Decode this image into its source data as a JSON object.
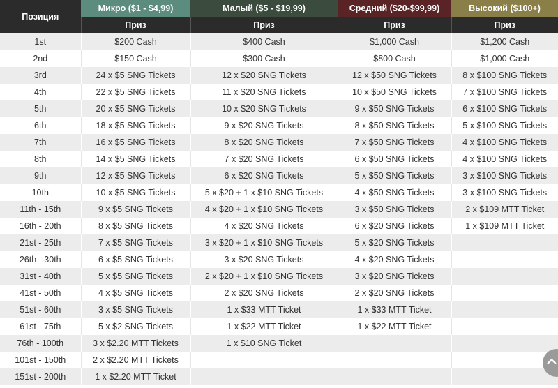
{
  "headers": {
    "position": "Позиция",
    "tiers": [
      "Микро ($1 - $4,99)",
      "Малый ($5 - $19,99)",
      "Средний ($20-$99,99)",
      "Высокий ($100+)"
    ],
    "prize_label": "Приз"
  },
  "tier_colors": {
    "micro": "#5c8c7d",
    "small": "#3b4b3d",
    "mid": "#5a2426",
    "high": "#8a7f49"
  },
  "rows": [
    [
      "1st",
      "$200 Cash",
      "$400 Cash",
      "$1,000 Cash",
      "$1,200 Cash"
    ],
    [
      "2nd",
      "$150 Cash",
      "$300 Cash",
      "$800 Cash",
      "$1,000 Cash"
    ],
    [
      "3rd",
      "24 x $5 SNG Tickets",
      "12 x $20 SNG Tickets",
      "12 x $50 SNG Tickets",
      "8 x $100 SNG Tickets"
    ],
    [
      "4th",
      "22 x $5 SNG Tickets",
      "11 x $20 SNG Tickets",
      "10 x $50 SNG Tickets",
      "7 x $100 SNG Tickets"
    ],
    [
      "5th",
      "20 x $5 SNG Tickets",
      "10 x $20 SNG Tickets",
      "9 x $50 SNG Tickets",
      "6 x $100 SNG Tickets"
    ],
    [
      "6th",
      "18 x $5 SNG Tickets",
      "9 x $20 SNG Tickets",
      "8 x $50 SNG Tickets",
      "5 x $100 SNG Tickets"
    ],
    [
      "7th",
      "16 x $5 SNG Tickets",
      "8 x $20 SNG Tickets",
      "7 x $50 SNG Tickets",
      "4 x $100 SNG Tickets"
    ],
    [
      "8th",
      "14 x $5 SNG Tickets",
      "7 x $20 SNG Tickets",
      "6 x $50 SNG Tickets",
      "4 x $100 SNG Tickets"
    ],
    [
      "9th",
      "12 x $5 SNG Tickets",
      "6 x $20 SNG Tickets",
      "5 x $50 SNG Tickets",
      "3 x $100 SNG Tickets"
    ],
    [
      "10th",
      "10 x $5 SNG Tickets",
      "5 x $20 + 1 x $10 SNG Tickets",
      "4 x $50 SNG Tickets",
      "3 x $100 SNG Tickets"
    ],
    [
      "11th - 15th",
      "9 x $5 SNG Tickets",
      "4 x $20 + 1 x $10 SNG Tickets",
      "3 x $50 SNG Tickets",
      "2 x $109 MTT Ticket"
    ],
    [
      "16th - 20th",
      "8 x $5 SNG Tickets",
      "4 x $20 SNG Tickets",
      "6 x $20 SNG Tickets",
      "1 x $109 MTT Ticket"
    ],
    [
      "21st - 25th",
      "7 x $5 SNG Tickets",
      "3 x $20 + 1 x $10 SNG Tickets",
      "5 x $20 SNG Tickets",
      ""
    ],
    [
      "26th - 30th",
      "6 x $5 SNG Tickets",
      "3 x $20 SNG Tickets",
      "4 x $20 SNG Tickets",
      ""
    ],
    [
      "31st - 40th",
      "5 x $5 SNG Tickets",
      "2 x $20 + 1 x $10 SNG Tickets",
      "3 x $20 SNG Tickets",
      ""
    ],
    [
      "41st - 50th",
      "4 x $5 SNG Tickets",
      "2 x $20 SNG Tickets",
      "2 x $20 SNG Tickets",
      ""
    ],
    [
      "51st - 60th",
      "3 x $5 SNG Tickets",
      "1 x $33 MTT Ticket",
      "1 x $33 MTT Ticket",
      ""
    ],
    [
      "61st - 75th",
      "5 x $2 SNG Tickets",
      "1 x $22 MTT Ticket",
      "1 x $22 MTT Ticket",
      ""
    ],
    [
      "76th - 100th",
      "3 x $2.20 MTT Tickets",
      "1 x $10 SNG Ticket",
      "",
      ""
    ],
    [
      "101st - 150th",
      "2 x $2.20 MTT Tickets",
      "",
      "",
      ""
    ],
    [
      "151st - 200th",
      "1 x $2.20 MTT Ticket",
      "",
      "",
      ""
    ]
  ],
  "scroll_button_icon": "chevron-up-icon"
}
